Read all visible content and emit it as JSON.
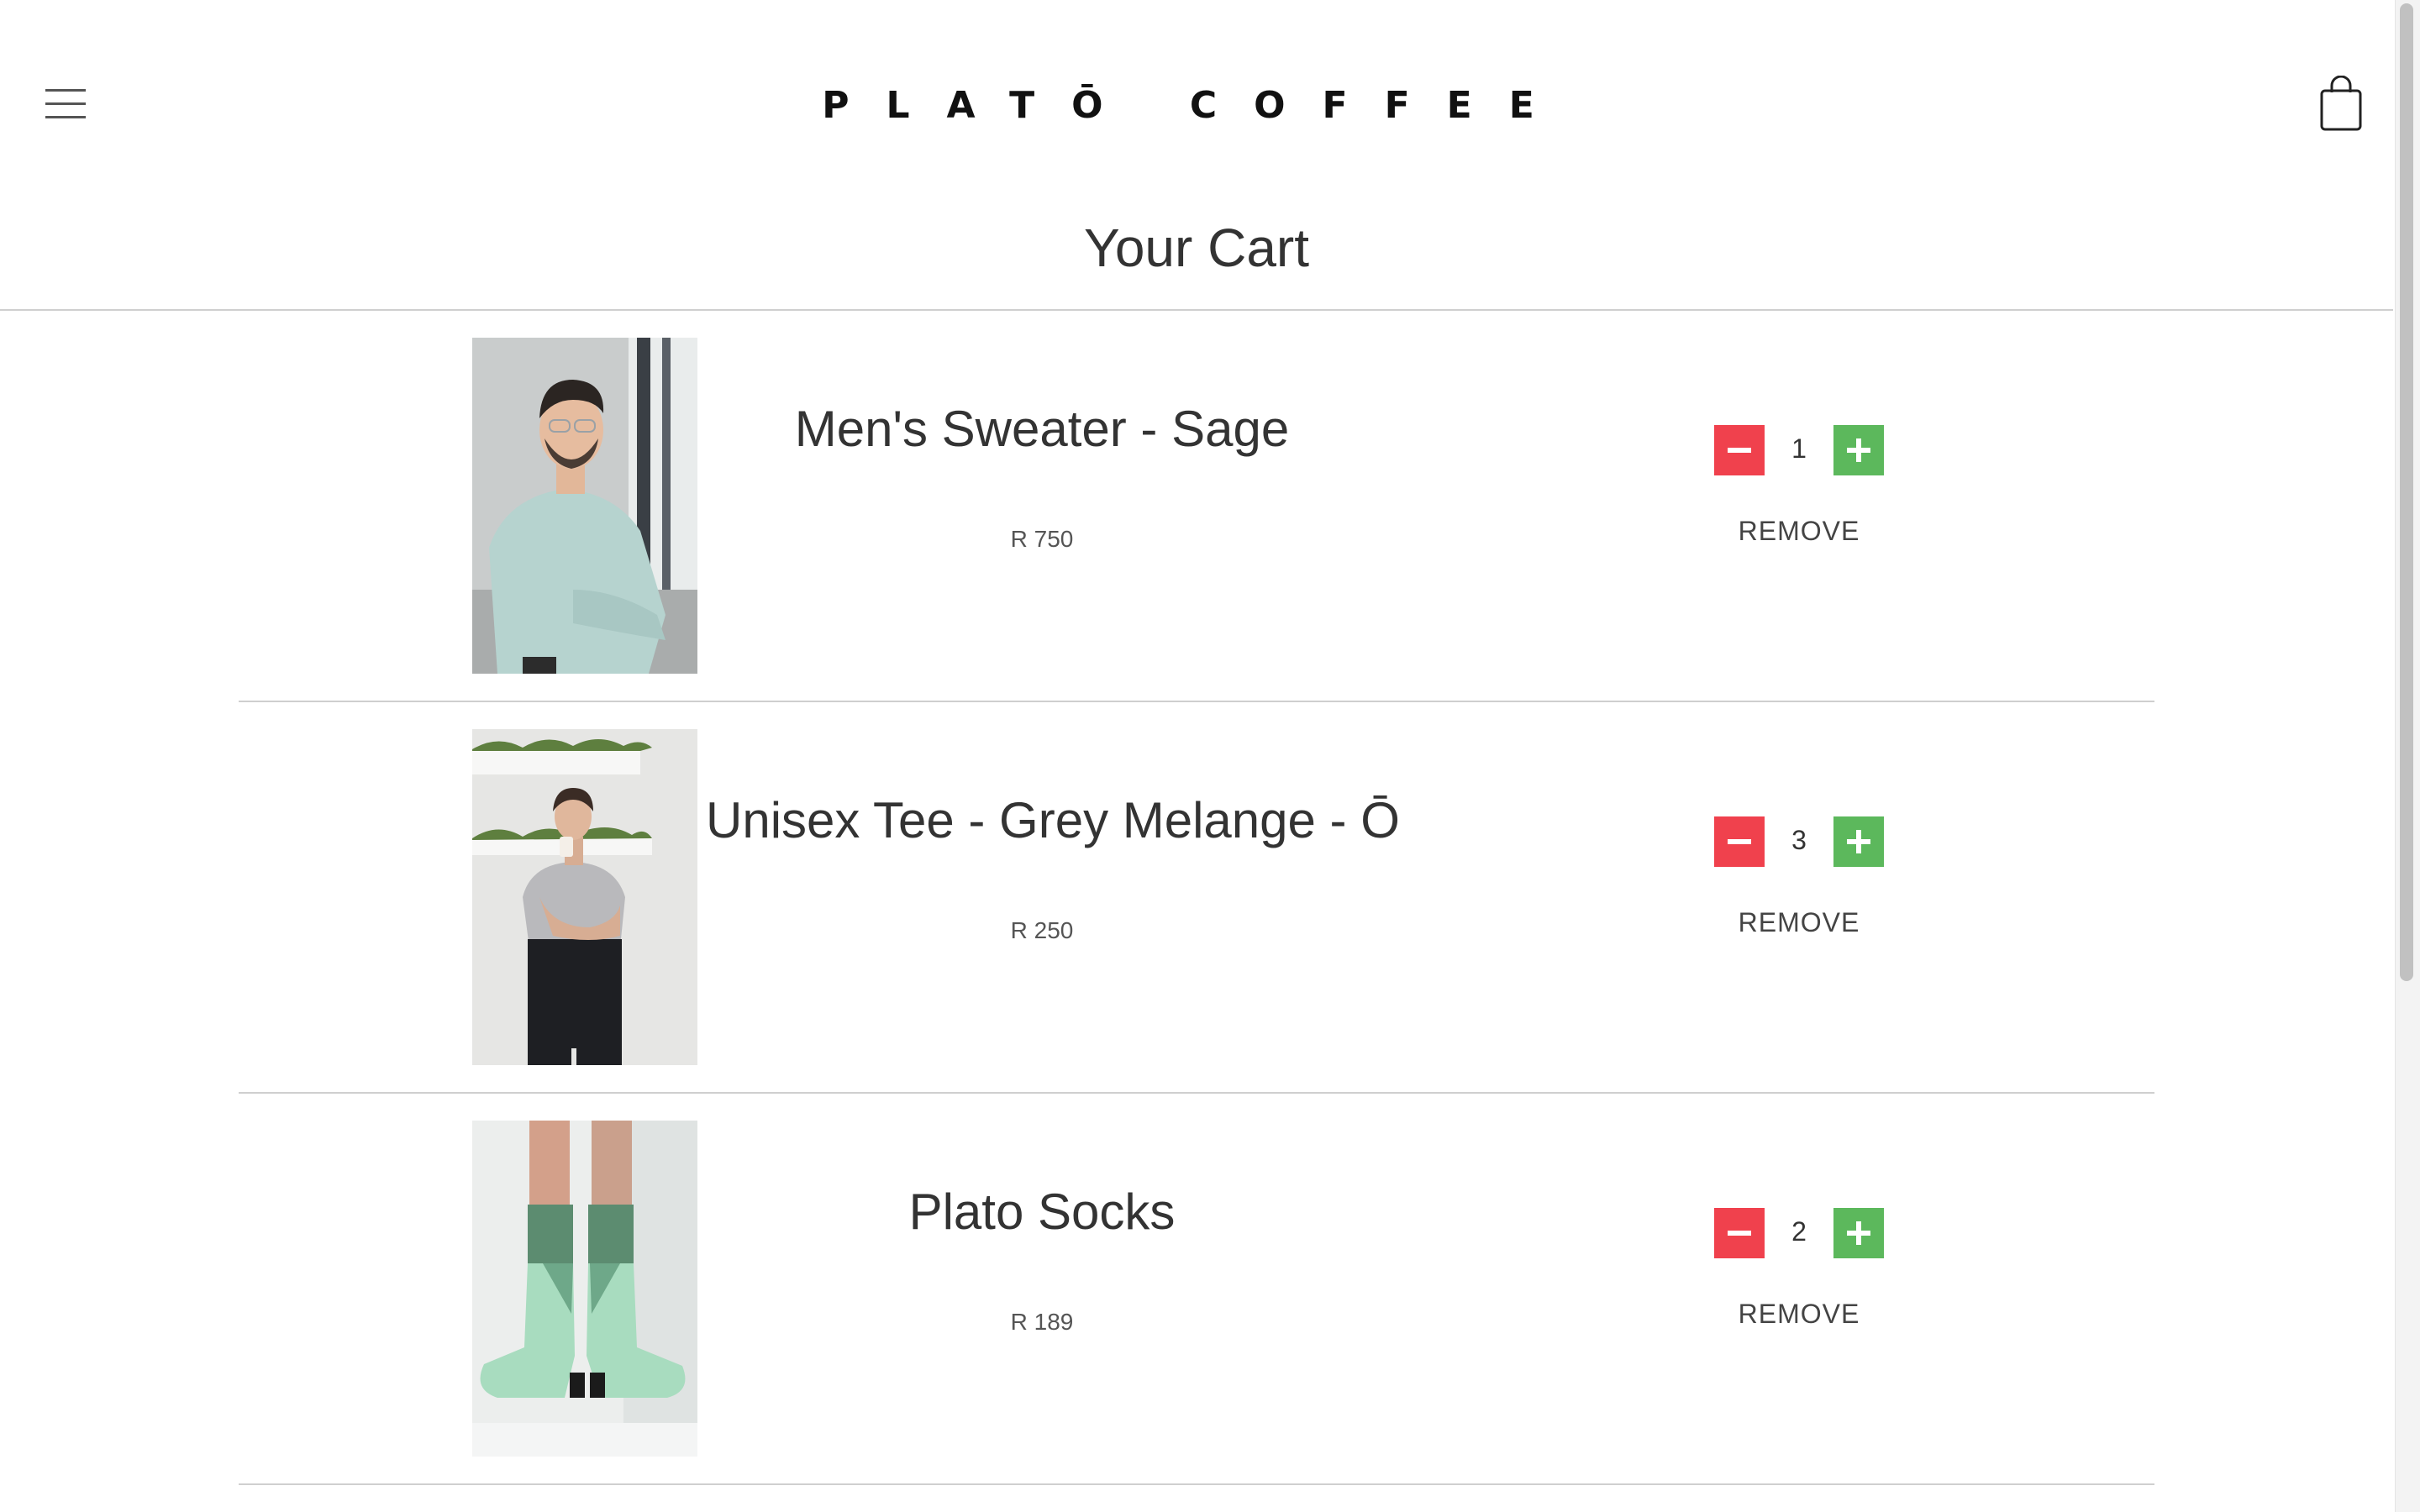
{
  "header": {
    "logo": "PLATŌ COFFEE",
    "menu_icon": "hamburger-menu-icon",
    "cart_icon": "shopping-bag-icon"
  },
  "page": {
    "title": "Your Cart"
  },
  "cart": {
    "items": [
      {
        "name": "Men's Sweater - Sage",
        "price": "R 750",
        "quantity": "1",
        "remove_label": "REMOVE",
        "image": "man-in-sage-sweater-photo"
      },
      {
        "name": "Unisex Tee - Grey Melange - Ō",
        "price": "R 250",
        "quantity": "3",
        "remove_label": "REMOVE",
        "image": "woman-in-grey-tee-photo"
      },
      {
        "name": "Plato Socks",
        "price": "R 189",
        "quantity": "2",
        "remove_label": "REMOVE",
        "image": "mint-green-socks-photo"
      }
    ]
  },
  "colors": {
    "decrement": "#f0414d",
    "increment": "#5cb85c",
    "divider": "#cfcfcf"
  }
}
